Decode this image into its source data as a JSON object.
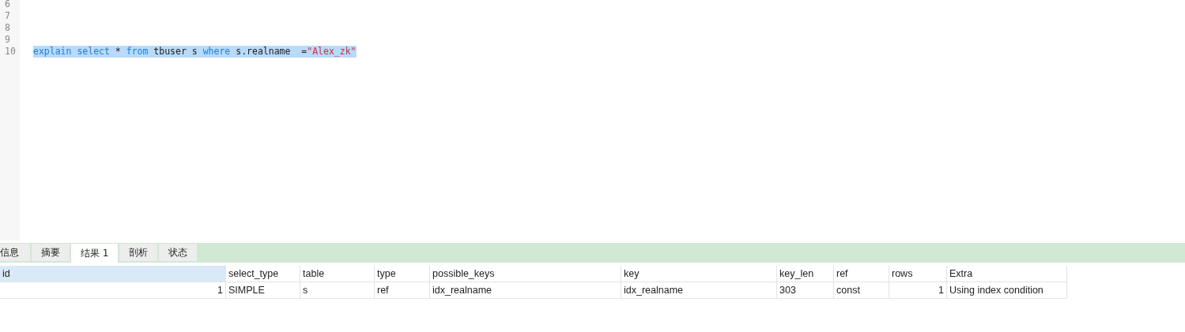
{
  "editor": {
    "lines": [
      {
        "number": "6"
      },
      {
        "number": "7"
      },
      {
        "number": "8"
      },
      {
        "number": "9"
      },
      {
        "number": "10",
        "selected": true,
        "tokens": [
          {
            "kind": "keyword",
            "text": "explain select"
          },
          {
            "kind": "plain",
            "text": " * "
          },
          {
            "kind": "keyword",
            "text": "from"
          },
          {
            "kind": "plain",
            "text": " tbuser s "
          },
          {
            "kind": "keyword",
            "text": "where"
          },
          {
            "kind": "plain",
            "text": " s.realname  ="
          },
          {
            "kind": "string",
            "text": "\"Alex_zk\""
          }
        ]
      }
    ]
  },
  "tabs": [
    {
      "label": "信息",
      "selected": false
    },
    {
      "label": "摘要",
      "selected": false
    },
    {
      "label": "结果 1",
      "selected": true
    },
    {
      "label": "剖析",
      "selected": false
    },
    {
      "label": "状态",
      "selected": false
    }
  ],
  "table": {
    "columns": [
      {
        "label": "id",
        "selected": true,
        "numeric": true
      },
      {
        "label": "select_type",
        "selected": false,
        "numeric": false
      },
      {
        "label": "table",
        "selected": false,
        "numeric": false
      },
      {
        "label": "type",
        "selected": false,
        "numeric": false
      },
      {
        "label": "possible_keys",
        "selected": false,
        "numeric": false
      },
      {
        "label": "key",
        "selected": false,
        "numeric": false
      },
      {
        "label": "key_len",
        "selected": false,
        "numeric": false
      },
      {
        "label": "ref",
        "selected": false,
        "numeric": false
      },
      {
        "label": "rows",
        "selected": false,
        "numeric": true
      },
      {
        "label": "Extra",
        "selected": false,
        "numeric": false
      }
    ],
    "rows": [
      [
        "1",
        "SIMPLE",
        "s",
        "ref",
        "idx_realname",
        "idx_realname",
        "303",
        "const",
        "1",
        "Using index condition"
      ]
    ]
  }
}
